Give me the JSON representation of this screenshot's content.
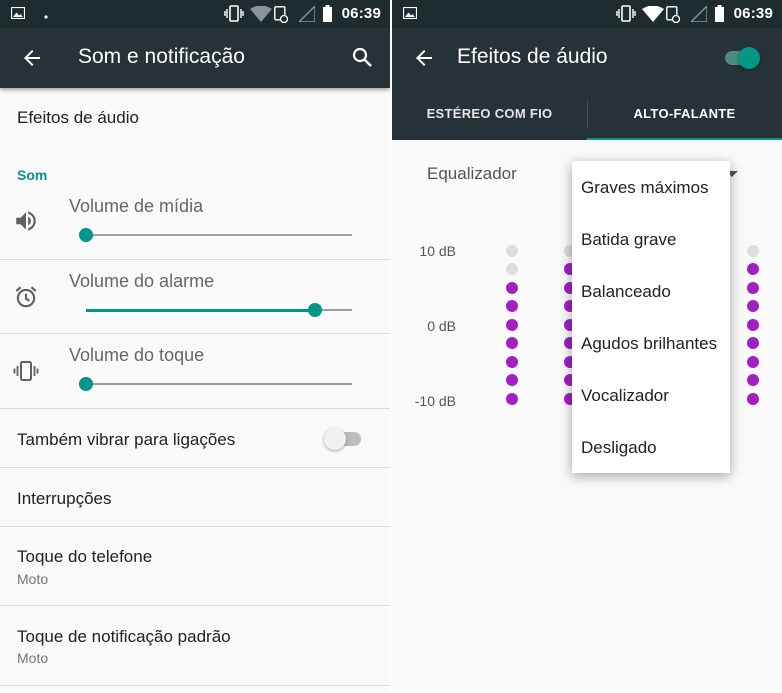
{
  "status_bar": {
    "time": "06:39"
  },
  "settings": {
    "title": "Som e notificação",
    "items": [
      {
        "title": "Efeitos de áudio"
      },
      {
        "section": "Som"
      },
      {
        "label": "Volume de mídia",
        "icon": "speaker-icon",
        "value": 0.0
      },
      {
        "label": "Volume do alarme",
        "icon": "alarm-icon",
        "value": 0.86
      },
      {
        "label": "Volume do toque",
        "icon": "vibrate-icon",
        "value": 0.0
      },
      {
        "title": "Também vibrar para ligações",
        "toggle": false
      },
      {
        "title": "Interrupções"
      },
      {
        "title": "Toque do telefone",
        "subtitle": "Moto"
      },
      {
        "title": "Toque de notificação padrão",
        "subtitle": "Moto"
      }
    ]
  },
  "audio_effects": {
    "title": "Efeitos de áudio",
    "enabled": true,
    "tabs": [
      {
        "label": "ESTÉREO COM FIO",
        "active": false
      },
      {
        "label": "ALTO-FALANTE",
        "active": true
      }
    ],
    "equalizer_label": "Equalizador",
    "db_labels": [
      "10 dB",
      "0 dB",
      "-10 dB"
    ],
    "preset_options": [
      "Graves máximos",
      "Batida grave",
      "Balanceado",
      "Agudos brilhantes",
      "Vocalizador",
      "Desligado"
    ]
  },
  "colors": {
    "accent": "#009688",
    "toolbar": "#263238",
    "statusbar": "#1e2b2f",
    "eq_dot_active": "#a21fc4",
    "eq_dot_inactive": "#dddddd"
  }
}
